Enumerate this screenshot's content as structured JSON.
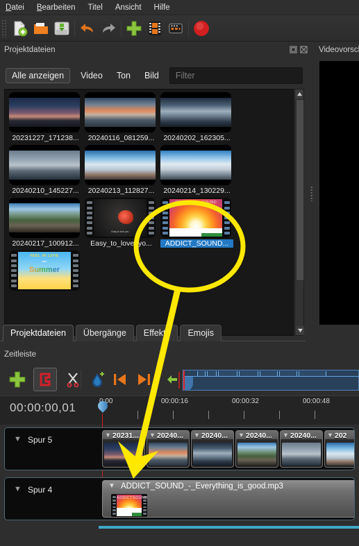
{
  "menu": {
    "items": [
      {
        "label": "Datei",
        "accel": "D"
      },
      {
        "label": "Bearbeiten",
        "accel": "B"
      },
      {
        "label": "Titel",
        "accel": ""
      },
      {
        "label": "Ansicht",
        "accel": ""
      },
      {
        "label": "Hilfe",
        "accel": ""
      }
    ]
  },
  "toolbar": {
    "icons": [
      "new-project-icon",
      "open-project-icon",
      "save-project-icon",
      "undo-icon",
      "redo-icon",
      "add-files-icon",
      "film-icon",
      "export-icon",
      "record-icon"
    ]
  },
  "project_panel": {
    "title": "Projektdateien",
    "float_button": "restore-icon",
    "close_button": "close-icon",
    "filters": {
      "show_all": "Alle anzeigen",
      "video": "Video",
      "audio": "Ton",
      "image": "Bild",
      "search_placeholder": "Filter",
      "search_value": ""
    },
    "files": [
      {
        "name": "20231227_171238...",
        "kind": "video",
        "art": "p1",
        "selected": false
      },
      {
        "name": "20240116_081259...",
        "kind": "video",
        "art": "p2",
        "selected": false
      },
      {
        "name": "20240202_162305...",
        "kind": "video",
        "art": "p3",
        "selected": false
      },
      {
        "name": "20240210_145227...",
        "kind": "video",
        "art": "p4",
        "selected": false
      },
      {
        "name": "20240213_112827...",
        "kind": "video",
        "art": "p5",
        "selected": false
      },
      {
        "name": "20240214_130229...",
        "kind": "video",
        "art": "p6",
        "selected": false
      },
      {
        "name": "20240217_100912...",
        "kind": "video",
        "art": "p7",
        "selected": false
      },
      {
        "name": "Easy_to_love_yo...",
        "kind": "audio",
        "art": "rose",
        "selected": false
      },
      {
        "name": "ADDICT_SOUND...",
        "kind": "audio",
        "art": "addict",
        "selected": true
      },
      {
        "name": "",
        "kind": "audio",
        "art": "summer",
        "selected": false
      }
    ],
    "album_art": {
      "addict_left": "ADDICT",
      "addict_right": "SOUND",
      "addict_sub": "Everything is good",
      "rose_sub": "Easy to love you",
      "summer_line1": "FEEL IN LOVE",
      "summer_line2": "with",
      "summer_line3": "Summer"
    },
    "tabs": [
      {
        "label": "Projektdateien",
        "active": true
      },
      {
        "label": "Übergänge",
        "active": false
      },
      {
        "label": "Effekte",
        "active": false
      },
      {
        "label": "Emojis",
        "active": false
      }
    ]
  },
  "preview_panel": {
    "title": "Videovorsch"
  },
  "timeline": {
    "title": "Zeitleiste",
    "position": "00:00:00,01",
    "buttons": [
      {
        "name": "add-track-button",
        "icon": "plus-icon"
      },
      {
        "name": "snap-toggle-button",
        "icon": "magnet-icon",
        "active": true
      },
      {
        "name": "cut-button",
        "icon": "scissors-icon"
      },
      {
        "name": "add-marker-button",
        "icon": "droplet-plus-icon"
      },
      {
        "name": "previous-marker-button",
        "icon": "skip-back-icon"
      },
      {
        "name": "next-marker-button",
        "icon": "skip-forward-icon"
      },
      {
        "name": "center-playhead-button",
        "icon": "green-arrow-left-icon"
      }
    ],
    "ruler_labels": [
      "0:00",
      "00:00:16",
      "00:00:32",
      "00:00:48"
    ],
    "tracks": [
      {
        "name": "Spur 5",
        "type": "video",
        "clips": [
          {
            "label": "20231...",
            "art": "p1"
          },
          {
            "label": "20240...",
            "art": "p2"
          },
          {
            "label": "20240...",
            "art": "p3"
          },
          {
            "label": "20240...",
            "art": "p7"
          },
          {
            "label": "20240...",
            "art": "p4"
          },
          {
            "label": "202",
            "art": "p5"
          }
        ]
      },
      {
        "name": "Spur 4",
        "type": "audio",
        "clips": [
          {
            "label": "ADDICT_SOUND_-_Everything_is_good.mp3",
            "art": "addict"
          }
        ]
      }
    ]
  },
  "annotation": {
    "type": "highlight-circle-with-arrow",
    "color": "#ffe800",
    "target_file": "ADDICT_SOUND...",
    "points_to": "Spur 4 audio clip"
  }
}
